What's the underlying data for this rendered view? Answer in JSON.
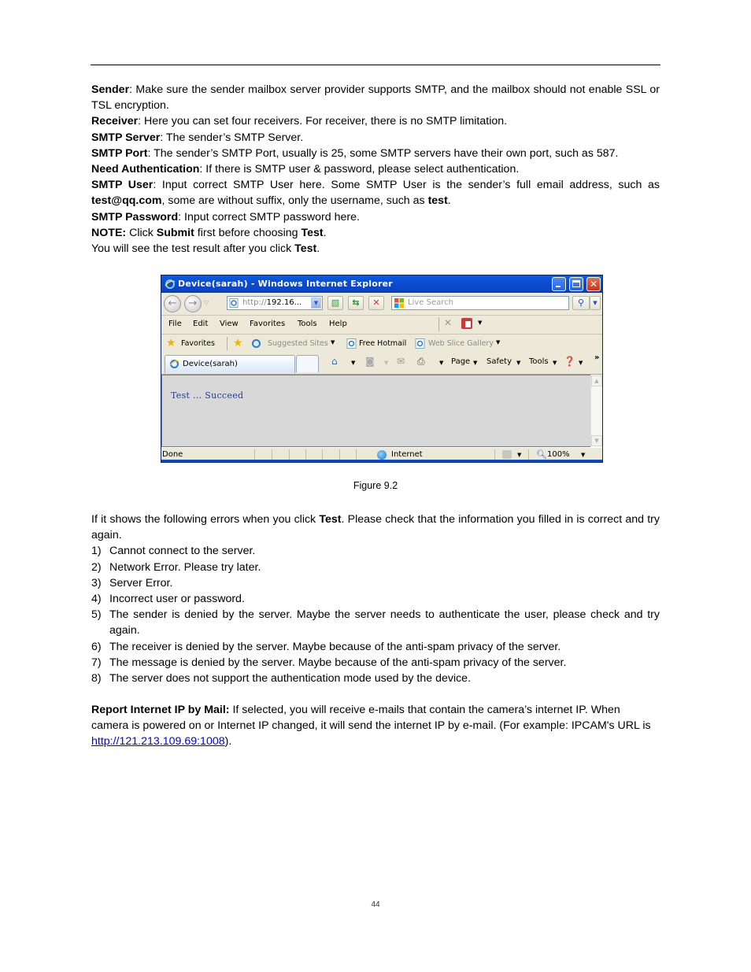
{
  "document": {
    "definitions": [
      {
        "term": "Sender",
        "text": ": Make sure the sender mailbox server provider supports SMTP, and the mailbox should not enable SSL or TSL encryption."
      },
      {
        "term": "Receiver",
        "text": ": Here you can set four receivers. For receiver, there is no SMTP limitation."
      },
      {
        "term": "SMTP Server",
        "text": ": The sender’s SMTP Server."
      },
      {
        "term": "SMTP Port",
        "text": ": The sender’s SMTP Port, usually is 25, some SMTP servers have their own port, such as 587."
      },
      {
        "term": "Need Authentication",
        "text": ": If there is SMTP user & password, please select authentication."
      }
    ],
    "smtp_user": {
      "term": "SMTP User",
      "text1": ": Input correct SMTP User here. Some SMTP User is the sender’s full email address, such as ",
      "example1": "test@qq.com",
      "text2": ", some are without suffix, only the username, such as ",
      "example2": "test",
      "text3": "."
    },
    "smtp_password": {
      "term": "SMTP Password",
      "text": ": Input correct SMTP password here."
    },
    "note": {
      "label": "NOTE:",
      "t1": " Click ",
      "submit": "Submit",
      "t2": " first before choosing ",
      "test": "Test",
      "t3": "."
    },
    "result_line": {
      "t1": "You will see the test result after you click ",
      "test": "Test",
      "t2": "."
    },
    "figure_caption": "Figure 9.2",
    "errors_intro": {
      "t1": "If it shows the following errors when you click ",
      "test": "Test",
      "t2": ". Please check that the information you filled in is correct and try again."
    },
    "errors": [
      {
        "num": "1)",
        "text": "Cannot connect to the server."
      },
      {
        "num": "2)",
        "text": "Network Error. Please try later."
      },
      {
        "num": "3)",
        "text": "Server Error."
      },
      {
        "num": "4)",
        "text": "Incorrect user or password."
      },
      {
        "num": "5)",
        "text": "The sender is denied by the server. Maybe the server needs to authenticate the user, please check and try again."
      },
      {
        "num": "6)",
        "text": "The receiver is denied by the server. Maybe because of the anti-spam privacy of the server."
      },
      {
        "num": "7)",
        "text": "The message is denied by the server. Maybe because of the anti-spam privacy of the server."
      },
      {
        "num": "8)",
        "text": "The server does not support the authentication mode used by the device."
      }
    ],
    "report_ip": {
      "term": "Report Internet IP by Mail:",
      "text": " If selected, you will receive e-mails that contain the camera’s internet IP. When camera is powered on or Internet IP changed, it will send the internet IP by e-mail. (For example: IPCAM's URL is ",
      "link": "http://121.213.109.69:1008",
      "tail": ")."
    },
    "page_number": "44"
  },
  "browser": {
    "title": "Device(sarah) - Windows Internet Explorer",
    "address_prefix": "http://",
    "address_host": "192.16...",
    "search_placeholder": "Live Search",
    "menu": [
      "File",
      "Edit",
      "View",
      "Favorites",
      "Tools",
      "Help"
    ],
    "favorites_label": "Favorites",
    "favorites_links": [
      "Suggested Sites",
      "Free Hotmail",
      "Web Slice Gallery"
    ],
    "tab_label": "Device(sarah)",
    "commands": [
      "Page",
      "Safety",
      "Tools"
    ],
    "chevron": "»",
    "content_message": "Test  ...  Succeed",
    "status_text": "Done",
    "zone": "Internet",
    "zoom_level": "100%"
  },
  "colors": {
    "link": "#0000ee",
    "title_bar": "#0b45c4",
    "content_bg": "#d8d8d8",
    "message_text": "#1f3d8f"
  }
}
